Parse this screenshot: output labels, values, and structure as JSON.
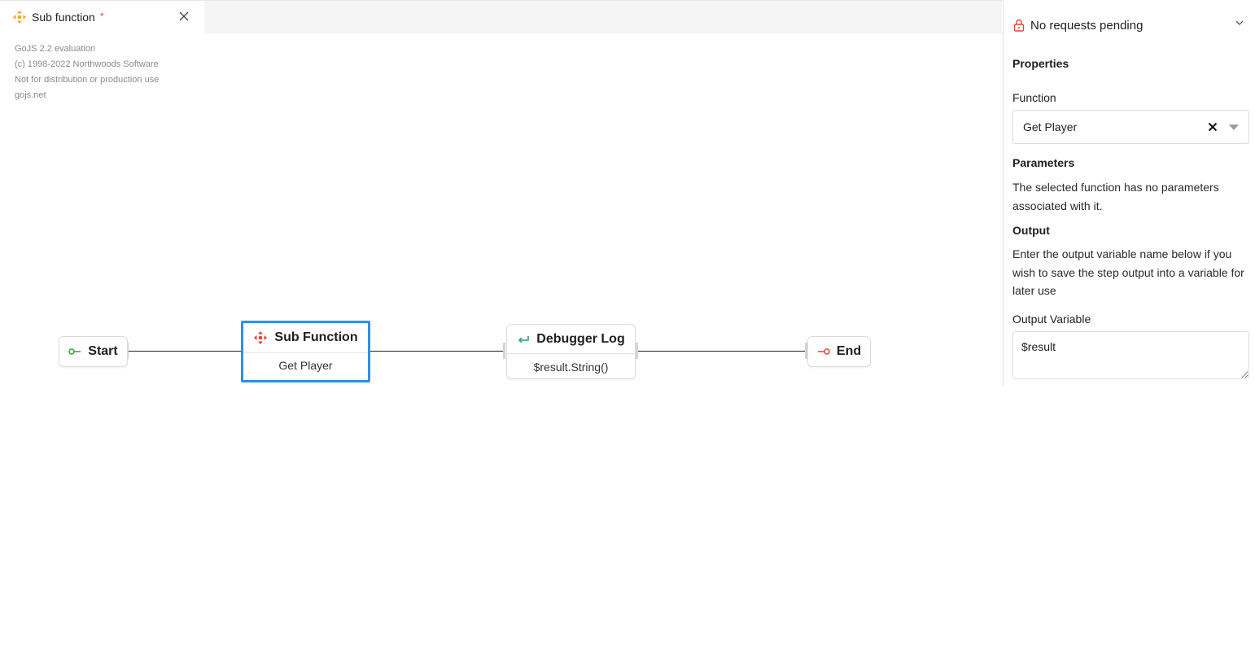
{
  "tab": {
    "title": "Sub function",
    "dirty_marker": "*",
    "icon": "sub-function-icon",
    "icon_color": "#f2a81d",
    "close_icon": "close-icon"
  },
  "watermark": {
    "lines": [
      "GoJS 2.2 evaluation",
      "(c) 1998-2022 Northwoods Software",
      "Not for distribution or production use",
      "gojs.net"
    ]
  },
  "diagram": {
    "nodes": {
      "start": {
        "label": "Start",
        "icon": "start-icon",
        "icon_color": "#3a9a3a"
      },
      "sub_function": {
        "title": "Sub Function",
        "subtitle": "Get Player",
        "icon": "sub-function-icon",
        "icon_color": "#e0463c",
        "selected": true
      },
      "debugger_log": {
        "title": "Debugger Log",
        "subtitle": "$result.String()",
        "icon": "log-return-icon",
        "icon_color": "#2a9d6a"
      },
      "end": {
        "label": "End",
        "icon": "end-icon",
        "icon_color": "#e0463c"
      }
    },
    "selection_color": "#2f8fea"
  },
  "panel": {
    "requests": {
      "text": "No requests pending",
      "icon": "lock-icon",
      "icon_color": "#e0463c",
      "chevron": "chevron-down-icon"
    },
    "properties_title": "Properties",
    "function_label": "Function",
    "function_value": "Get Player",
    "parameters_title": "Parameters",
    "parameters_text": "The selected function has no parameters associated with it.",
    "output_title": "Output",
    "output_text": "Enter the output variable name below if you wish to save the step output into a variable for later use",
    "output_variable_label": "Output Variable",
    "output_variable_value": "$result"
  }
}
